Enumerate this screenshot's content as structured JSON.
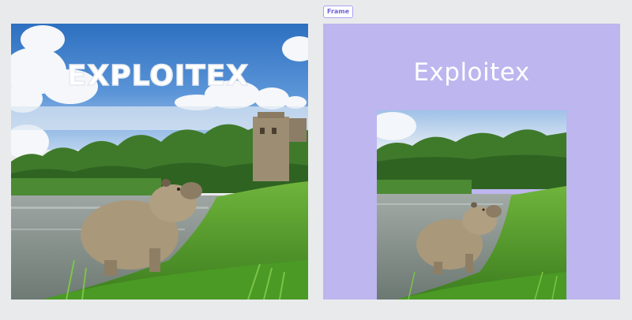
{
  "cloud_text": "EXPLOITEX",
  "frame": {
    "label": "Frame",
    "title": "Exploitex"
  },
  "images": {
    "left": "capybara-by-lake-photo-with-cloud-lettering",
    "right": "capybara-by-lake-photo-cropped"
  },
  "colors": {
    "workspace_bg": "#e9eaec",
    "frame_bg": "#bdb6ef",
    "frame_label": "#6f63d6",
    "title_text": "#ffffff"
  }
}
